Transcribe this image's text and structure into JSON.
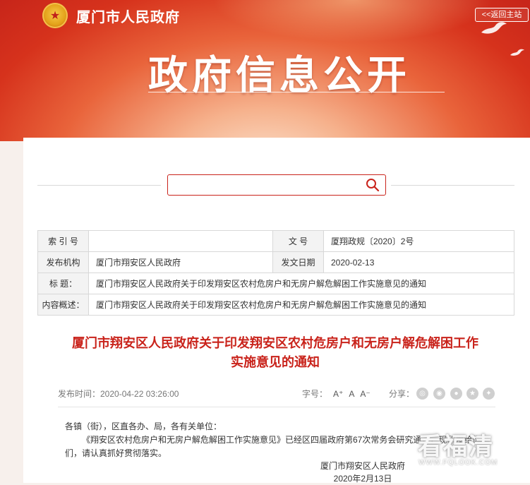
{
  "header": {
    "city_title": "厦门市人民政府",
    "back_label": "<<返回主站",
    "main_title": "政府信息公开"
  },
  "search": {
    "placeholder": ""
  },
  "info_table": {
    "index_label": "索 引 号",
    "index_value": "",
    "docno_label": "文 号",
    "docno_value": "厦翔政规〔2020〕2号",
    "org_label": "发布机构",
    "org_value": "厦门市翔安区人民政府",
    "date_label": "发文日期",
    "date_value": "2020-02-13",
    "title_label": "标 题：",
    "title_value": "厦门市翔安区人民政府关于印发翔安区农村危房户和无房户解危解困工作实施意见的通知",
    "summary_label": "内容概述：",
    "summary_value": "厦门市翔安区人民政府关于印发翔安区农村危房户和无房户解危解困工作实施意见的通知"
  },
  "article": {
    "title_line1": "厦门市翔安区人民政府关于印发翔安区农村危房户和无房户解危解困工作",
    "title_line2": "实施意见的通知",
    "publish_time": "发布时间：2020-04-22 03:26:00",
    "fontsize_label": "字号：",
    "fs_large": "A⁺",
    "fs_mid": "A",
    "fs_small": "A⁻",
    "share_label": "分享：",
    "greeting": "各镇（街），区直各办、局，各有关单位：",
    "para1": "《翔安区农村危房户和无房户解危解困工作实施意见》已经区四届政府第67次常务会研究通过，现印发给你",
    "para1_cont": "们，请认真抓好贯彻落实。",
    "signer": "厦门市翔安区人民政府",
    "sign_date": "2020年2月13日"
  },
  "watermark": {
    "text": "看福清",
    "url": "WWW.FQLOOK.COM"
  },
  "colors": {
    "accent": "#c9231b",
    "banner": "#d6321c"
  },
  "icons": [
    "national-emblem-icon",
    "search-icon",
    "wechat-icon",
    "weibo-icon",
    "qzone-icon",
    "star-icon",
    "more-icon"
  ]
}
